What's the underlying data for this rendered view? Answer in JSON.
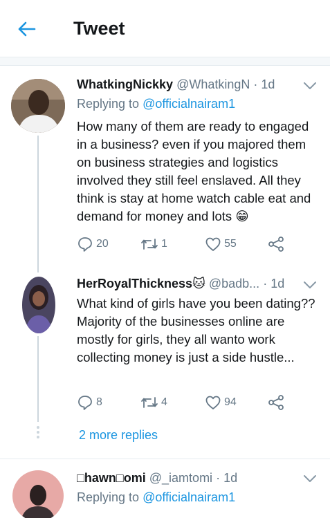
{
  "header": {
    "title": "Tweet"
  },
  "colors": {
    "accent": "#1b95e0",
    "text": "#14171a",
    "muted": "#657786",
    "line": "#ccd6dd"
  },
  "tweets": [
    {
      "name": "WhatkingNickky",
      "handle": "@WhatkingN",
      "dot": "·",
      "time": "1d",
      "replying_prefix": "Replying to",
      "replying_to": "@officialnairam1",
      "text": "How many of them are ready to engaged in a business? even if you majored them on business strategies and logistics involved they still feel enslaved. All they think is stay at home watch cable eat and demand for money and lots 😁",
      "replies": "20",
      "retweets": "1",
      "likes": "55"
    },
    {
      "name": "HerRoyalThickness🐱",
      "handle": "@badb...",
      "dot": "·",
      "time": "1d",
      "text": "What kind of girls have you been dating?? Majority of the businesses online are mostly for girls, they all wanto work collecting money is just a side hustle...",
      "replies": "8",
      "retweets": "4",
      "likes": "94"
    },
    {
      "name": "□hawn□omi",
      "handle": "@_iamtomi",
      "dot": "·",
      "time": "1d",
      "replying_prefix": "Replying to",
      "replying_to": "@officialnairam1"
    }
  ],
  "more_replies": "2 more replies",
  "icons": [
    "back-arrow-icon",
    "chevron-down-icon",
    "reply-icon",
    "retweet-icon",
    "like-icon",
    "share-icon"
  ]
}
